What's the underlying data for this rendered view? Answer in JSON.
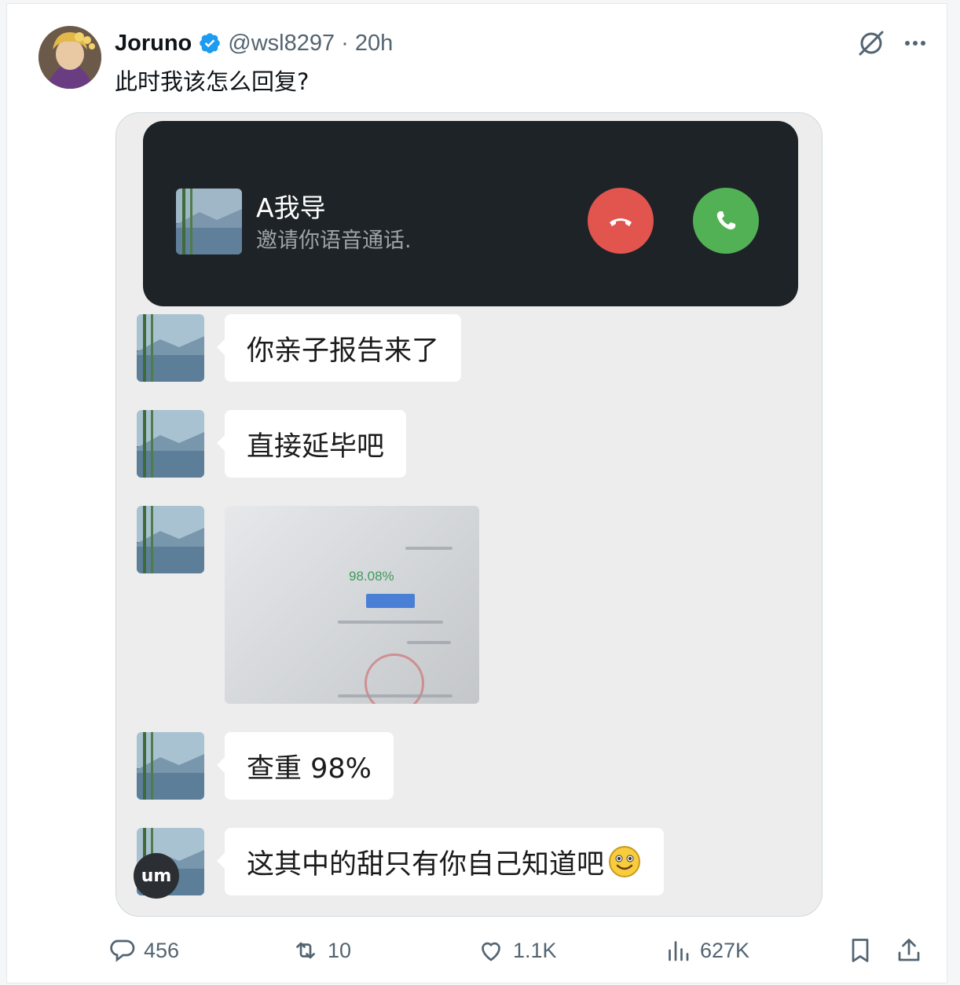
{
  "tweet": {
    "author_name": "Joruno",
    "handle_time": "@wsl8297 · 20h",
    "text": "此时我该怎么回复?"
  },
  "icons": {
    "verified": "verified-badge-icon",
    "grok": "grok-icon",
    "more": "more-options-icon",
    "reply": "reply-icon",
    "retweet": "retweet-icon",
    "like": "like-icon",
    "views": "views-icon",
    "bookmark": "bookmark-icon",
    "share": "share-icon"
  },
  "media": {
    "call": {
      "caller": "A我导",
      "subtitle": "邀请你语音通话."
    },
    "messages": [
      {
        "text": "你亲子报告来了"
      },
      {
        "text": "直接延毕吧"
      },
      {
        "text": "查重 98%"
      },
      {
        "text": "这其中的甜只有你自己知道吧"
      }
    ],
    "photo": {
      "percentage": "98.08%"
    },
    "badge": "um"
  },
  "stats": {
    "replies": "456",
    "retweets": "10",
    "likes": "1.1K",
    "views": "627K"
  },
  "colors": {
    "accent": "#1d9bf0",
    "decline": "#e2544e",
    "accept": "#52b155"
  }
}
